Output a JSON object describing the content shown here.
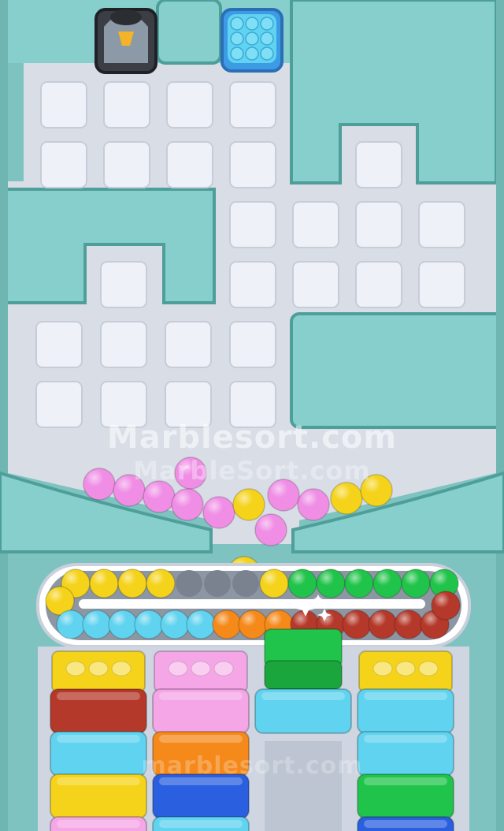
{
  "watermark": {
    "main": "Marblesort.com",
    "secondary": "MarbleSort.com",
    "faint": "marblesort.com"
  },
  "colors": {
    "board_bg": "#d8dde6",
    "wall": "#86cfcc",
    "wall_dark": "#4e9e9a",
    "tile": "#eef1f7",
    "pink": "#f08ee6",
    "yellow": "#f5d31a",
    "green": "#21c44a",
    "red": "#b5392a",
    "orange": "#f5891a",
    "cyan": "#5fd3ef",
    "blue": "#2a5fe0",
    "lightpink": "#f4a6e6"
  },
  "board": {
    "blocked_spawner": "mystery-box",
    "spawner_color": "cyan"
  },
  "falling_marbles": [
    "pink",
    "pink",
    "pink",
    "pink",
    "pink",
    "pink",
    "pink",
    "pink",
    "pink",
    "yellow",
    "yellow",
    "yellow",
    "yellow"
  ],
  "conveyor": {
    "top_row": [
      "yellow",
      "yellow",
      "yellow",
      "yellow",
      "empty",
      "empty",
      "empty",
      "yellow",
      "green",
      "green",
      "green",
      "green",
      "green",
      "green"
    ],
    "bottom_row": [
      "cyan",
      "cyan",
      "cyan",
      "cyan",
      "cyan",
      "cyan",
      "orange",
      "orange",
      "orange",
      "red",
      "red",
      "red",
      "red",
      "red",
      "red"
    ]
  },
  "columns": [
    {
      "name": "column-1",
      "top": "yellow",
      "items": [
        "red",
        "cyan",
        "yellow",
        "lightpink"
      ]
    },
    {
      "name": "column-2",
      "top": "lightpink",
      "items": [
        "lightpink",
        "orange",
        "blue",
        "cyan"
      ]
    },
    {
      "name": "column-3",
      "top": "green",
      "items": [
        "cyan"
      ]
    },
    {
      "name": "column-4",
      "top": "yellow",
      "items": [
        "cyan",
        "cyan",
        "green",
        "blue"
      ]
    }
  ]
}
